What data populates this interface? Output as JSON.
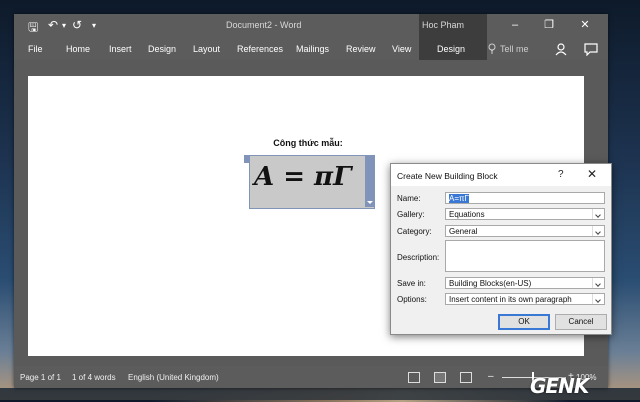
{
  "window": {
    "doc_title": "Document2  -  Word",
    "context_label": "Hoc Pham",
    "buttons": {
      "minimize": "–",
      "restore": "❐",
      "close": "✕"
    },
    "quick_access": {
      "save": "🖫",
      "undo": "↶",
      "undo_arrow": "▾",
      "redo": "↺",
      "customize": "▾"
    }
  },
  "ribbon": {
    "tabs": [
      "File",
      "Home",
      "Insert",
      "Design",
      "Layout",
      "References",
      "Mailings",
      "Review",
      "View",
      "Design"
    ],
    "tell_me": "Tell me"
  },
  "document": {
    "caption": "Công thức mẫu:",
    "equation": "A = πΓ"
  },
  "status": {
    "page": "Page 1 of 1",
    "words": "1 of 4 words",
    "language": "English (United Kingdom)",
    "zoom_minus": "–",
    "zoom_plus": "+",
    "zoom": "100%"
  },
  "dialog": {
    "title": "Create New Building Block",
    "help": "?",
    "close": "✕",
    "fields": {
      "name_label": "Name:",
      "name_value": "A=πΓ",
      "gallery_label": "Gallery:",
      "gallery_value": "Equations",
      "category_label": "Category:",
      "category_value": "General",
      "description_label": "Description:",
      "savein_label": "Save in:",
      "savein_value": "Building Blocks(en-US)",
      "options_label": "Options:",
      "options_value": "Insert content in its own paragraph"
    },
    "ok": "OK",
    "cancel": "Cancel"
  },
  "watermark": "GENK"
}
